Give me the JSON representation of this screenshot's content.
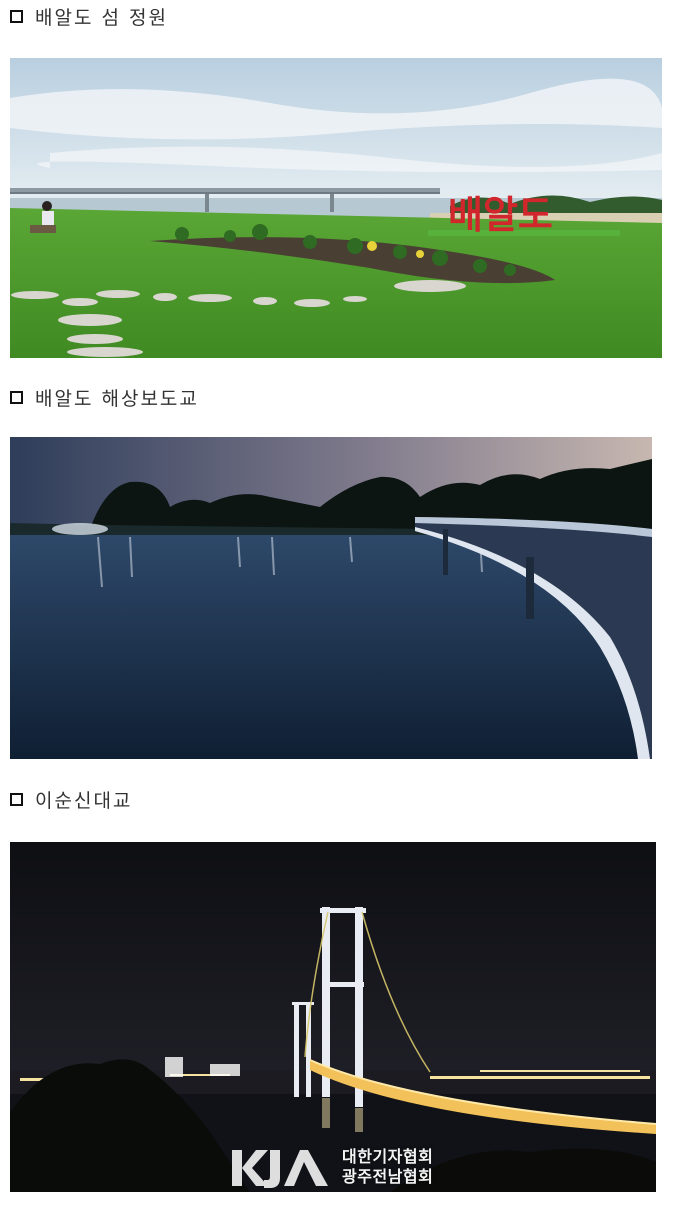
{
  "sections": [
    {
      "heading": "배알도 섬 정원",
      "photo": "garden-photo"
    },
    {
      "heading": "배알도 해상보도교",
      "photo": "footbridge-photo"
    },
    {
      "heading": "이순신대교",
      "photo": "suspension-bridge-photo"
    }
  ],
  "garden_sign": "배알도",
  "watermark": {
    "logo": "KJA",
    "line1": "대한기자협회",
    "line2": "광주전남협회"
  },
  "colors": {
    "grass": "#4f9a2c",
    "sign_red": "#d0262c",
    "night_sky": "#17181c",
    "bridge_light": "#f3c15a"
  }
}
